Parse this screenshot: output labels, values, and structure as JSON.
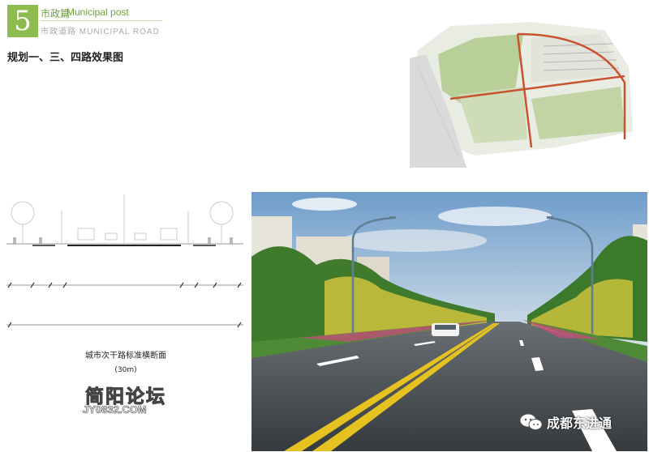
{
  "header": {
    "number": "5",
    "category_cn": "市政篇",
    "category_en": "Municipal post",
    "subtitle_cn": "市政道路",
    "subtitle_en": "MUNICIPAL ROAD"
  },
  "page_title": "规划一、三、四路效果图",
  "section_caption": "城市次干路标准横断面",
  "section_width": "(30m)",
  "logo": {
    "line1": "简阳论坛",
    "line2": "JY0832.COM"
  },
  "watermark": "成都东进通",
  "colors": {
    "accent_green": "#8dbb4d",
    "road_red": "#c8532f"
  }
}
